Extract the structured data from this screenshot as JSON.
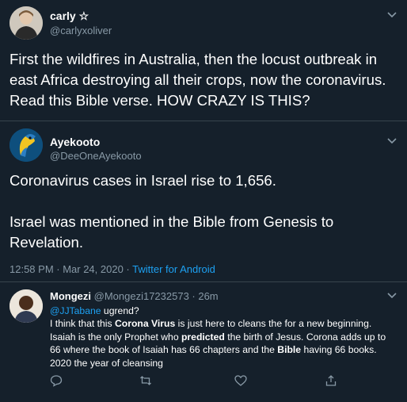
{
  "tweet1": {
    "name": "carly ☆",
    "handle": "@carlyxoliver",
    "text": "First the wildfires in Australia, then the locust outbreak in east Africa destroying all their crops, now the coronavirus. Read this Bible verse. HOW CRAZY IS THIS?"
  },
  "tweet2": {
    "name": "Ayekooto",
    "handle": "@DeeOneAyekooto",
    "text_line1": "Coronavirus cases in Israel rise to 1,656.",
    "text_line2": "Israel was mentioned in the Bible from Genesis to Revelation.",
    "timestamp": "12:58 PM · Mar 24, 2020 · ",
    "source": "Twitter for Android"
  },
  "reply": {
    "name": "Mongezi",
    "handle": "@Mongezi17232573 · 26m",
    "mention": "@JJTabane",
    "mention_rest": " ugrend?",
    "p1": "I think that this ",
    "b1": "Corona Virus",
    "p2": " is just here to cleans the for a new beginning. Isaiah is the only Prophet who ",
    "b2": "predicted",
    "p3": " the birth of Jesus. Corona adds up to 66 where the book of Isaiah has 66 chapters and the ",
    "b3": "Bible",
    "p4": " having 66 books. 2020 the year of cleansing"
  },
  "icons": {
    "more": "chevron-down-icon",
    "reply": "comment-icon",
    "retweet": "retweet-icon",
    "like": "heart-icon",
    "share": "share-icon"
  },
  "colors": {
    "background": "#15202b",
    "muted": "#8899a6",
    "accent": "#1da1f2",
    "separator": "#38444d"
  }
}
